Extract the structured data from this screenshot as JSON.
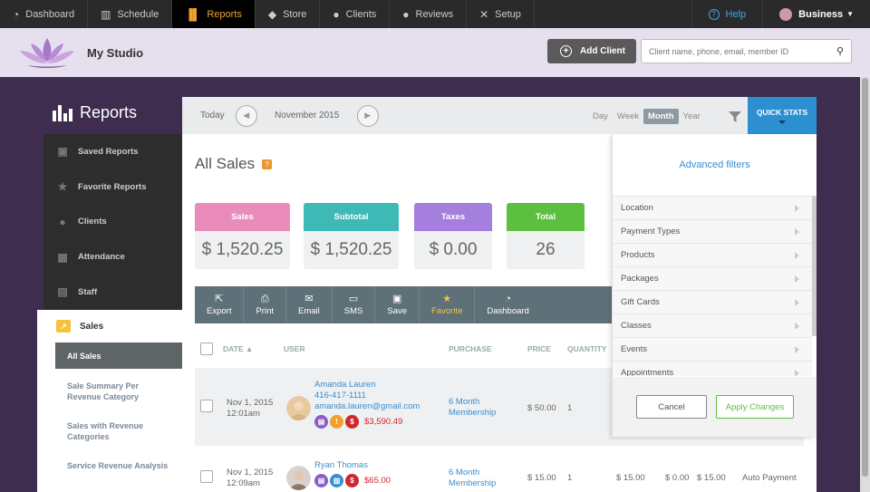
{
  "topnav": {
    "items": [
      {
        "label": "Dashboard",
        "icon": "gauge-icon"
      },
      {
        "label": "Schedule",
        "icon": "calendar-icon"
      },
      {
        "label": "Reports",
        "icon": "bar-chart-icon",
        "active": true
      },
      {
        "label": "Store",
        "icon": "tag-icon"
      },
      {
        "label": "Clients",
        "icon": "person-icon"
      },
      {
        "label": "Reviews",
        "icon": "speech-bubble-icon"
      },
      {
        "label": "Setup",
        "icon": "tools-icon"
      }
    ],
    "help": "Help",
    "business": "Business",
    "active_color": "#f0a030"
  },
  "studio": {
    "name": "My Studio",
    "add_client": "Add Client",
    "search_placeholder": "Client name, phone, email, member ID"
  },
  "sidebar": {
    "title": "Reports",
    "items": [
      {
        "label": "Saved Reports",
        "icon": "save-icon"
      },
      {
        "label": "Favorite Reports",
        "icon": "star-icon"
      },
      {
        "label": "Clients",
        "icon": "person-icon"
      },
      {
        "label": "Attendance",
        "icon": "calendar-check-icon"
      },
      {
        "label": "Staff",
        "icon": "staff-icon"
      }
    ],
    "sales_section": "Sales",
    "sales_items": [
      {
        "label": "All Sales",
        "active": true
      },
      {
        "label": "Sale Summary Per Revenue Category"
      },
      {
        "label": "Sales with Revenue Categories"
      },
      {
        "label": "Service Revenue Analysis"
      }
    ]
  },
  "datebar": {
    "today": "Today",
    "month": "November 2015",
    "ranges": [
      "Day",
      "Week",
      "Month",
      "Year"
    ],
    "selected_range": "Month",
    "quick_stats": "QUICK STATS"
  },
  "page_title": "All Sales",
  "help_badge": "?",
  "stats": [
    {
      "label": "Sales",
      "value": "$ 1,520.25",
      "color": "#e98bbb"
    },
    {
      "label": "Subtotal",
      "value": "$ 1,520.25",
      "color": "#3eb9b5"
    },
    {
      "label": "Taxes",
      "value": "$ 0.00",
      "color": "#a57fde"
    },
    {
      "label": "Total",
      "value": "26",
      "color": "#5cbf3f"
    }
  ],
  "toolbar": [
    {
      "label": "Export",
      "icon": "export-icon"
    },
    {
      "label": "Print",
      "icon": "print-icon"
    },
    {
      "label": "Email",
      "icon": "envelope-icon"
    },
    {
      "label": "SMS",
      "icon": "sms-icon"
    },
    {
      "label": "Save",
      "icon": "save-icon"
    },
    {
      "label": "Favorite",
      "icon": "star-icon"
    },
    {
      "label": "Dashboard",
      "icon": "gauge-icon"
    }
  ],
  "table": {
    "headers": {
      "date": "DATE ▲",
      "user": "USER",
      "purchase": "PURCHASE",
      "price": "PRICE",
      "quantity": "QUANTITY"
    },
    "rows": [
      {
        "date": "Nov 1, 2015",
        "time": "12:01am",
        "name": "Amanda Lauren",
        "phone": "416-417-1111",
        "email": "amanda.lauren@gmail.com",
        "balance": "$3,590.49",
        "purchase_line1": "6 Month",
        "purchase_line2": "Membership",
        "price": "$ 50.00",
        "quantity": "1"
      },
      {
        "date": "Nov 1, 2015",
        "time": "12:09am",
        "name": "Ryan Thomas",
        "balance": "$65.00",
        "purchase_line1": "6 Month",
        "purchase_line2": "Membership",
        "price": "$ 15.00",
        "quantity": "1",
        "subtotal": "$ 15.00",
        "tax": "$ 0.00",
        "total": "$ 15.00",
        "payment": "Auto Payment"
      }
    ]
  },
  "filters": {
    "title": "Advanced filters",
    "items": [
      "Location",
      "Payment Types",
      "Products",
      "Packages",
      "Gift Cards",
      "Classes",
      "Events",
      "Appointments"
    ],
    "cancel": "Cancel",
    "apply": "Apply Changes"
  }
}
